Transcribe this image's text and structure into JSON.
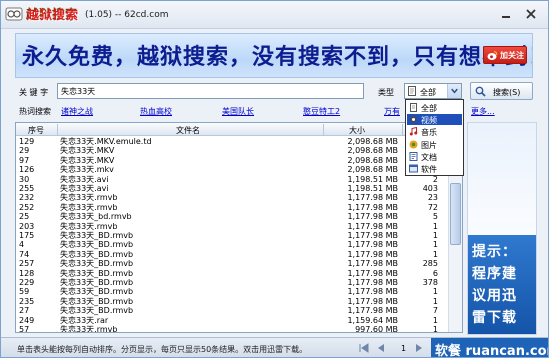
{
  "window": {
    "app_name": "越狱搜索",
    "version_text": "(1.05) -- 62cd.com",
    "minimize_glyph": "—",
    "close_glyph": "×"
  },
  "banner": {
    "slogan": "永久免费，越狱搜索，没有搜索不到，只有想不到！",
    "follow_label": "加关注"
  },
  "search": {
    "keyword_label": "关 键 字",
    "keyword_value": "失恋33天",
    "type_label": "类型",
    "type_selected": "全部",
    "button_label": "搜索(S)"
  },
  "type_options": [
    {
      "label": "全部",
      "icon": "document-icon",
      "selected": false
    },
    {
      "label": "视频",
      "icon": "video-icon",
      "selected": true
    },
    {
      "label": "音乐",
      "icon": "music-note-icon",
      "selected": false
    },
    {
      "label": "图片",
      "icon": "image-icon",
      "selected": false
    },
    {
      "label": "文档",
      "icon": "text-document-icon",
      "selected": false
    },
    {
      "label": "软件",
      "icon": "software-icon",
      "selected": false
    }
  ],
  "hot": {
    "label": "热词搜索",
    "links": [
      "诸神之战",
      "热血高校",
      "美国队长",
      "憨豆特工2",
      "万有"
    ],
    "more_label": "更多..."
  },
  "results": {
    "columns": [
      "序号",
      "文件名",
      "大小"
    ],
    "rows": [
      {
        "id": "129",
        "name": "失恋33天.MKV.emule.td",
        "size": "2,098.68 MB",
        "count": ""
      },
      {
        "id": "29",
        "name": "失恋33天.MKV",
        "size": "2,098.68 MB",
        "count": ""
      },
      {
        "id": "97",
        "name": "失恋33天.MKV",
        "size": "2,098.68 MB",
        "count": ""
      },
      {
        "id": "126",
        "name": "失恋33天.mkv",
        "size": "2,098.68 MB",
        "count": ""
      },
      {
        "id": "30",
        "name": "失恋33天.avi",
        "size": "1,198.51 MB",
        "count": "2"
      },
      {
        "id": "255",
        "name": "失恋33天.avi",
        "size": "1,198.51 MB",
        "count": "403"
      },
      {
        "id": "232",
        "name": "失恋33天.rmvb",
        "size": "1,177.98 MB",
        "count": "23"
      },
      {
        "id": "252",
        "name": "失恋33天.rmvb",
        "size": "1,177.98 MB",
        "count": "72"
      },
      {
        "id": "25",
        "name": "失恋33天_bd.rmvb",
        "size": "1,177.98 MB",
        "count": "5"
      },
      {
        "id": "203",
        "name": "失恋33天.rmvb",
        "size": "1,177.98 MB",
        "count": "1"
      },
      {
        "id": "175",
        "name": "失恋33天_BD.rmvb",
        "size": "1,177.98 MB",
        "count": "1"
      },
      {
        "id": "4",
        "name": "失恋33天_BD.rmvb",
        "size": "1,177.98 MB",
        "count": "1"
      },
      {
        "id": "74",
        "name": "失恋33天_BD.rmvb",
        "size": "1,177.98 MB",
        "count": "1"
      },
      {
        "id": "257",
        "name": "失恋33天_BD.rmvb",
        "size": "1,177.98 MB",
        "count": "285"
      },
      {
        "id": "128",
        "name": "失恋33天_BD.rmvb",
        "size": "1,177.98 MB",
        "count": "6"
      },
      {
        "id": "229",
        "name": "失恋33天_BD.rmvb",
        "size": "1,177.98 MB",
        "count": "378"
      },
      {
        "id": "59",
        "name": "失恋33天_BD.rmvb",
        "size": "1,177.98 MB",
        "count": "1"
      },
      {
        "id": "235",
        "name": "失恋33天_BD.rmvb",
        "size": "1,177.98 MB",
        "count": "1"
      },
      {
        "id": "27",
        "name": "失恋33天_BD.rmvb",
        "size": "1,177.98 MB",
        "count": "7"
      },
      {
        "id": "249",
        "name": "失恋33天.rar",
        "size": "1,159.64 MB",
        "count": "1"
      },
      {
        "id": "57",
        "name": "失恋33天.rmvb",
        "size": "997.60 MB",
        "count": "1"
      }
    ]
  },
  "side_ad": {
    "lines": [
      "提示：",
      "程序建",
      "议用迅",
      "雷下载"
    ]
  },
  "status": {
    "text": "单击表头能按每列自动排序。分页显示，每页只显示50条结果。双击用迅雷下载。",
    "page_number": "1",
    "watermark": "软餐 ruancan.com"
  },
  "colors": {
    "banner_text": "#0d1d8f",
    "link": "#0000cc",
    "selection": "#1f4fb8",
    "ad_blue": "#1454a8",
    "follow_red": "#d9241b"
  }
}
